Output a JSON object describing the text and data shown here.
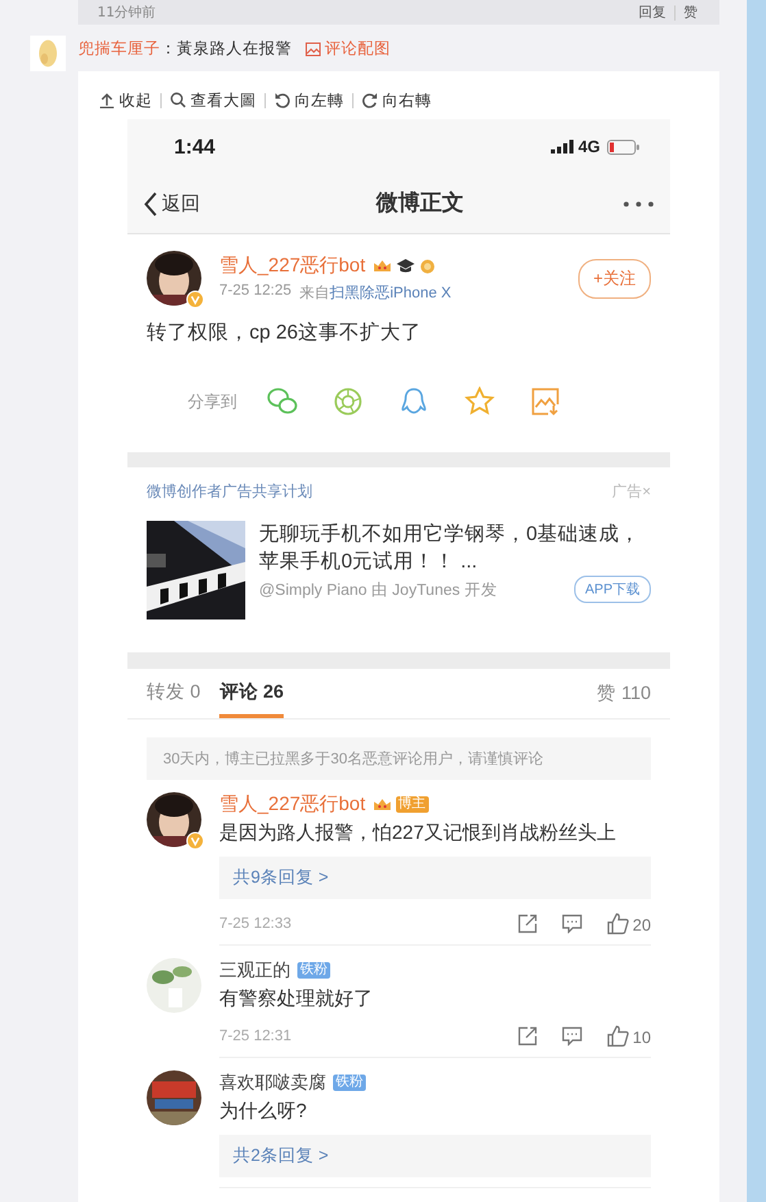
{
  "top_strip": {
    "time": "11分钟前",
    "actions": [
      "回复",
      "赞"
    ]
  },
  "comment": {
    "author": "兜揣车厘子",
    "separator": "：",
    "text": "黃泉路人在报警",
    "attachment": "评论配图"
  },
  "image_toolbar": [
    {
      "kind": "collapse",
      "label": "收起"
    },
    {
      "kind": "zoom",
      "label": "查看大圖"
    },
    {
      "kind": "rotate-left",
      "label": "向左轉"
    },
    {
      "kind": "rotate-right",
      "label": "向右轉"
    }
  ],
  "phone": {
    "status": {
      "time": "1:44",
      "network": "4G"
    },
    "nav": {
      "back": "返回",
      "title": "微博正文"
    },
    "post": {
      "author": "雪人_227恶行bot",
      "verified": true,
      "time": "7-25 12:25",
      "source_prefix": "来自",
      "source": "扫黑除恶iPhone X",
      "follow": "+关注",
      "text": "转了权限，cp 26这事不扩大了",
      "share_label": "分享到"
    },
    "ad": {
      "program": "微博创作者广告共享计划",
      "tag": "广告×",
      "title": "无聊玩手机不如用它学钢琴，0基础速成，苹果手机0元试用！！ ...",
      "source": "@Simply Piano 由 JoyTunes 开发",
      "button": "APP下载"
    },
    "tabs": [
      {
        "label": "转发 0",
        "selected": false
      },
      {
        "label": "评论 26",
        "selected": true
      }
    ],
    "likes": "赞 110",
    "notice": "30天内，博主已拉黑多于30名恶意评论用户，请谨慎评论",
    "comments": [
      {
        "author": "雪人_227恶行bot",
        "crown": true,
        "verified": true,
        "badge": {
          "kind": "host",
          "label": "博主"
        },
        "text": "是因为路人报警，怕227又记恨到肖战粉丝头上",
        "replies": "共9条回复 >",
        "time": "7-25 12:33",
        "likes": "20"
      },
      {
        "author": "三观正的",
        "crown": false,
        "verified": false,
        "badge": {
          "kind": "fan",
          "label": "铁粉"
        },
        "text": "有警察处理就好了",
        "time": "7-25 12:31",
        "likes": "10"
      },
      {
        "author": "喜欢耶啵卖腐",
        "crown": false,
        "verified": false,
        "badge": {
          "kind": "fan",
          "label": "铁粉"
        },
        "text": "为什么呀?",
        "replies": "共2条回复 >"
      }
    ]
  }
}
